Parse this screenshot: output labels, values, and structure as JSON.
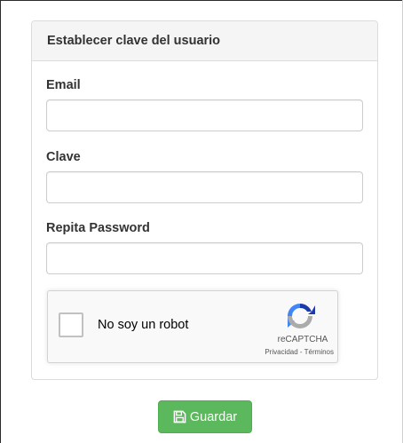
{
  "form": {
    "title": "Establecer clave del usuario",
    "fields": [
      {
        "label": "Email",
        "value": "",
        "placeholder": ""
      },
      {
        "label": "Clave",
        "value": "",
        "placeholder": ""
      },
      {
        "label": "Repita Password",
        "value": "",
        "placeholder": ""
      }
    ]
  },
  "captcha": {
    "checkbox_label": "No soy un robot",
    "brand": "reCAPTCHA",
    "links": "Privacidad - Términos",
    "icon": "recaptcha-logo-icon"
  },
  "actions": {
    "save_label": "Guardar",
    "save_icon": "floppy-disk-icon"
  },
  "colors": {
    "save_button": "#5cb85c",
    "panel_heading_bg": "#f5f5f5"
  }
}
